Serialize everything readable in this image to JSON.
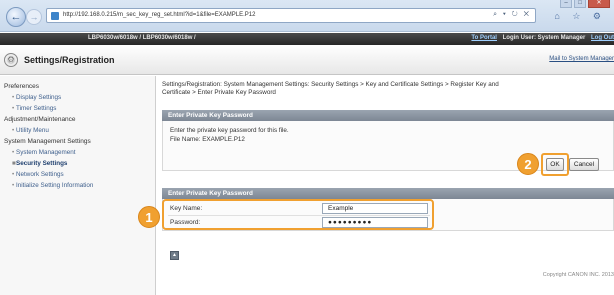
{
  "browser": {
    "url": "http://192.168.0.215/m_sec_key_reg_set.html?id=1&file=EXAMPLE.P12",
    "addr_icons": "⌕ ▾ ↻ ✕",
    "toolbar_icons": "⌂ ☆ ⚙",
    "window_buttons": {
      "minimize": "–",
      "maximize": "□",
      "close": "✕"
    }
  },
  "banner": {
    "device": "LBP6030w/6018w / LBP6030w/6018w /",
    "portal_link": "To Portal",
    "login_text": "Login User: System Manager",
    "logout_link": "Log Out"
  },
  "header": {
    "title": "Settings/Registration",
    "mail_link": "Mail to System Manager"
  },
  "sidebar": {
    "categories": [
      {
        "label": "Preferences",
        "items": [
          {
            "label": "Display Settings"
          },
          {
            "label": "Timer Settings"
          }
        ]
      },
      {
        "label": "Adjustment/Maintenance",
        "items": [
          {
            "label": "Utility Menu"
          }
        ]
      },
      {
        "label": "System Management Settings",
        "items": [
          {
            "label": "System Management"
          },
          {
            "label": "Security Settings",
            "active": true
          },
          {
            "label": "Network Settings"
          },
          {
            "label": "Initialize Setting Information"
          }
        ]
      }
    ]
  },
  "main": {
    "breadcrumb_line1": "Settings/Registration: System Management Settings: Security Settings > Key and Certificate Settings > Register Key and",
    "breadcrumb_line2": "Certificate > Enter Private Key Password",
    "panel1_title": "Enter Private Key Password",
    "message": "Enter the private key password for this file.",
    "file_name_text": "File Name: EXAMPLE.P12",
    "ok_label": "OK",
    "cancel_label": "Cancel",
    "panel2_title": "Enter Private Key Password",
    "key_name_label": "Key Name:",
    "key_name_value": "Example",
    "password_label": "Password:",
    "password_value": "●●●●●●●●●",
    "top_icon": "▲",
    "copyright": "Copyright CANON INC. 2013"
  },
  "callouts": {
    "one": "1",
    "two": "2"
  },
  "colors": {
    "accent": "#f0a030",
    "panel_header": "#8a949f",
    "banner": "#333333",
    "link": "#3e5f8c"
  }
}
